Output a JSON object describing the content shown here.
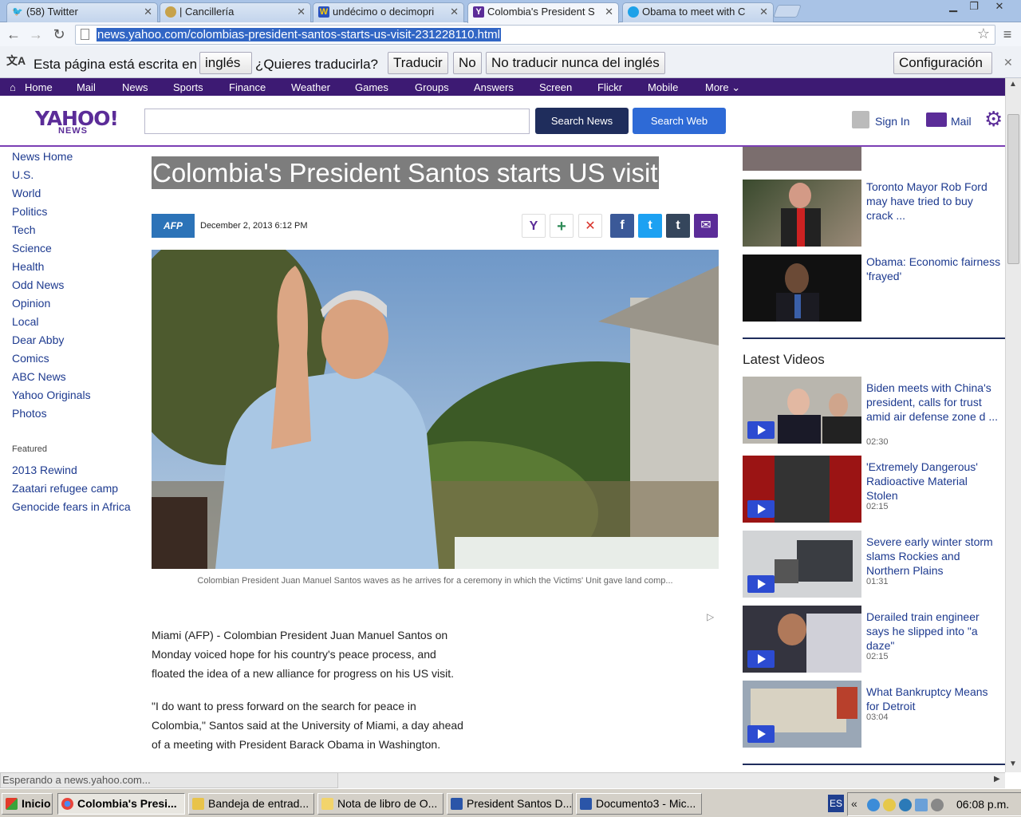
{
  "browser": {
    "tabs": [
      {
        "label": "(58) Twitter",
        "icon": "twitter-icon",
        "color": "#4aa3df"
      },
      {
        "label": "| Cancillería",
        "icon": "seal-icon",
        "color": "#c7a24a"
      },
      {
        "label": "undécimo o decimopri",
        "icon": "wordreference-icon",
        "color": "#2a52be"
      },
      {
        "label": "Colombia's President S",
        "icon": "yahoo-icon",
        "color": "#5b2c98"
      },
      {
        "label": "Obama to meet with C",
        "icon": "globe-icon",
        "color": "#1ea1e8"
      }
    ],
    "url": "news.yahoo.com/colombias-president-santos-starts-us-visit-231228110.html",
    "translate": {
      "prefix": "Esta página está escrita en",
      "language": "inglés",
      "question": "¿Quieres traducirla?",
      "translate_btn": "Traducir",
      "no_btn": "No",
      "never_btn": "No traducir nunca del inglés",
      "config_btn": "Configuración"
    },
    "status": "Esperando a news.yahoo.com..."
  },
  "yahoo_nav": [
    "Home",
    "Mail",
    "News",
    "Sports",
    "Finance",
    "Weather",
    "Games",
    "Groups",
    "Answers",
    "Screen",
    "Flickr",
    "Mobile",
    "More"
  ],
  "header": {
    "logo": "YAHOO!",
    "logo_sub": "NEWS",
    "search_news": "Search News",
    "search_web": "Search Web",
    "sign_in": "Sign In",
    "mail": "Mail"
  },
  "left_nav": {
    "items": [
      "News Home",
      "U.S.",
      "World",
      "Politics",
      "Tech",
      "Science",
      "Health",
      "Odd News",
      "Opinion",
      "Local",
      "Dear Abby",
      "Comics",
      "ABC News",
      "Yahoo Originals",
      "Photos"
    ],
    "featured_label": "Featured",
    "featured": [
      "2013 Rewind",
      "Zaatari refugee camp",
      "Genocide fears in Africa"
    ]
  },
  "article": {
    "title": "Colombia's President Santos starts US visit",
    "source": "AFP",
    "date": "December 2, 2013 6:12 PM",
    "caption": "Colombian President Juan Manuel Santos waves as he arrives for a ceremony in which the Victims' Unit gave land comp...",
    "paragraphs": [
      "Miami (AFP) - Colombian President Juan Manuel Santos on Monday voiced hope for his country's peace process, and floated the idea of a new alliance for progress on his US visit.",
      "\"I do want to press forward on the search for peace in Colombia,\" Santos said at the University of Miami, a day ahead of a meeting with President Barack Obama in Washington."
    ]
  },
  "right_rail": {
    "stories": [
      {
        "title": "Toronto Mayor Rob Ford may have tried to buy crack ..."
      },
      {
        "title": "Obama: Economic fairness 'frayed'"
      }
    ],
    "latest_videos_label": "Latest Videos",
    "videos": [
      {
        "title": "Biden meets with China's president, calls for trust amid air defense zone d ...",
        "duration": "02:30"
      },
      {
        "title": "'Extremely Dangerous' Radioactive Material Stolen",
        "duration": "02:15"
      },
      {
        "title": "Severe early winter storm slams Rockies and Northern Plains",
        "duration": "01:31"
      },
      {
        "title": "Derailed train engineer says he slipped into \"a daze\"",
        "duration": "02:15"
      },
      {
        "title": "What Bankruptcy Means for Detroit",
        "duration": "03:04"
      }
    ]
  },
  "taskbar": {
    "start": "Inicio",
    "tasks": [
      "Colombia's Presi...",
      "Bandeja de entrad...",
      "Nota de libro de O...",
      "President Santos D...",
      "Documento3 - Mic..."
    ],
    "lang": "ES",
    "clock": "06:08 p.m."
  }
}
